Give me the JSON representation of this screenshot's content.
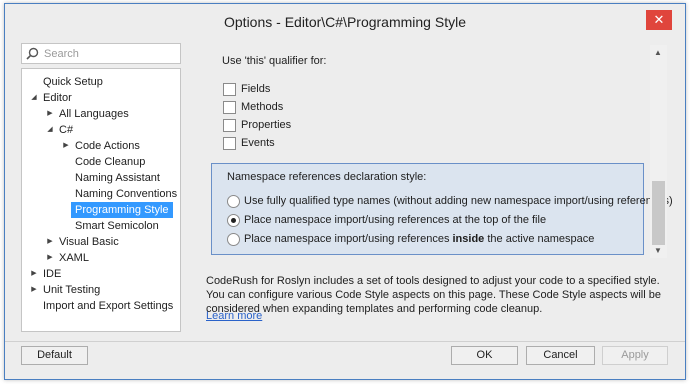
{
  "window": {
    "title": "Options - Editor\\C#\\Programming Style",
    "close_glyph": "✕"
  },
  "search": {
    "placeholder": "Search"
  },
  "tree": [
    {
      "label": "Quick Setup",
      "arrow": ""
    },
    {
      "label": "Editor",
      "arrow": "◢"
    },
    {
      "label": "All Languages",
      "arrow": "▶"
    },
    {
      "label": "C#",
      "arrow": "◢"
    },
    {
      "label": "Code Actions",
      "arrow": "▶"
    },
    {
      "label": "Code Cleanup",
      "arrow": ""
    },
    {
      "label": "Naming Assistant",
      "arrow": ""
    },
    {
      "label": "Naming Conventions",
      "arrow": ""
    },
    {
      "label": "Programming Style",
      "arrow": "",
      "selected": true
    },
    {
      "label": "Smart Semicolon",
      "arrow": ""
    },
    {
      "label": "Visual Basic",
      "arrow": "▶"
    },
    {
      "label": "XAML",
      "arrow": "▶"
    },
    {
      "label": "IDE",
      "arrow": "▶"
    },
    {
      "label": "Unit Testing",
      "arrow": "▶"
    },
    {
      "label": "Import and Export Settings",
      "arrow": ""
    }
  ],
  "qualifier": {
    "heading": "Use 'this' qualifier for:",
    "options": [
      {
        "label": "Fields",
        "checked": false
      },
      {
        "label": "Methods",
        "checked": false
      },
      {
        "label": "Properties",
        "checked": false
      },
      {
        "label": "Events",
        "checked": false
      }
    ]
  },
  "namespace": {
    "heading": "Namespace references declaration style:",
    "options": [
      {
        "label": "Use fully qualified type names (without adding new namespace import/using references)",
        "checked": false
      },
      {
        "label": "Place namespace import/using references at the top of the file",
        "checked": true
      },
      {
        "label_before": "Place namespace import/using references ",
        "label_bold": "inside",
        "label_after": " the active namespace",
        "checked": false
      }
    ]
  },
  "description": {
    "text": "CodeRush for Roslyn includes a set of tools designed to adjust your code to a specified style. You can configure various Code Style aspects on this page. These Code Style aspects will be considered when expanding templates and performing code cleanup.",
    "link": "Learn more"
  },
  "scrollbar": {
    "up_glyph": "▲",
    "down_glyph": "▼"
  },
  "buttons": {
    "default": "Default",
    "ok": "OK",
    "cancel": "Cancel",
    "apply": "Apply",
    "apply_enabled": false
  }
}
